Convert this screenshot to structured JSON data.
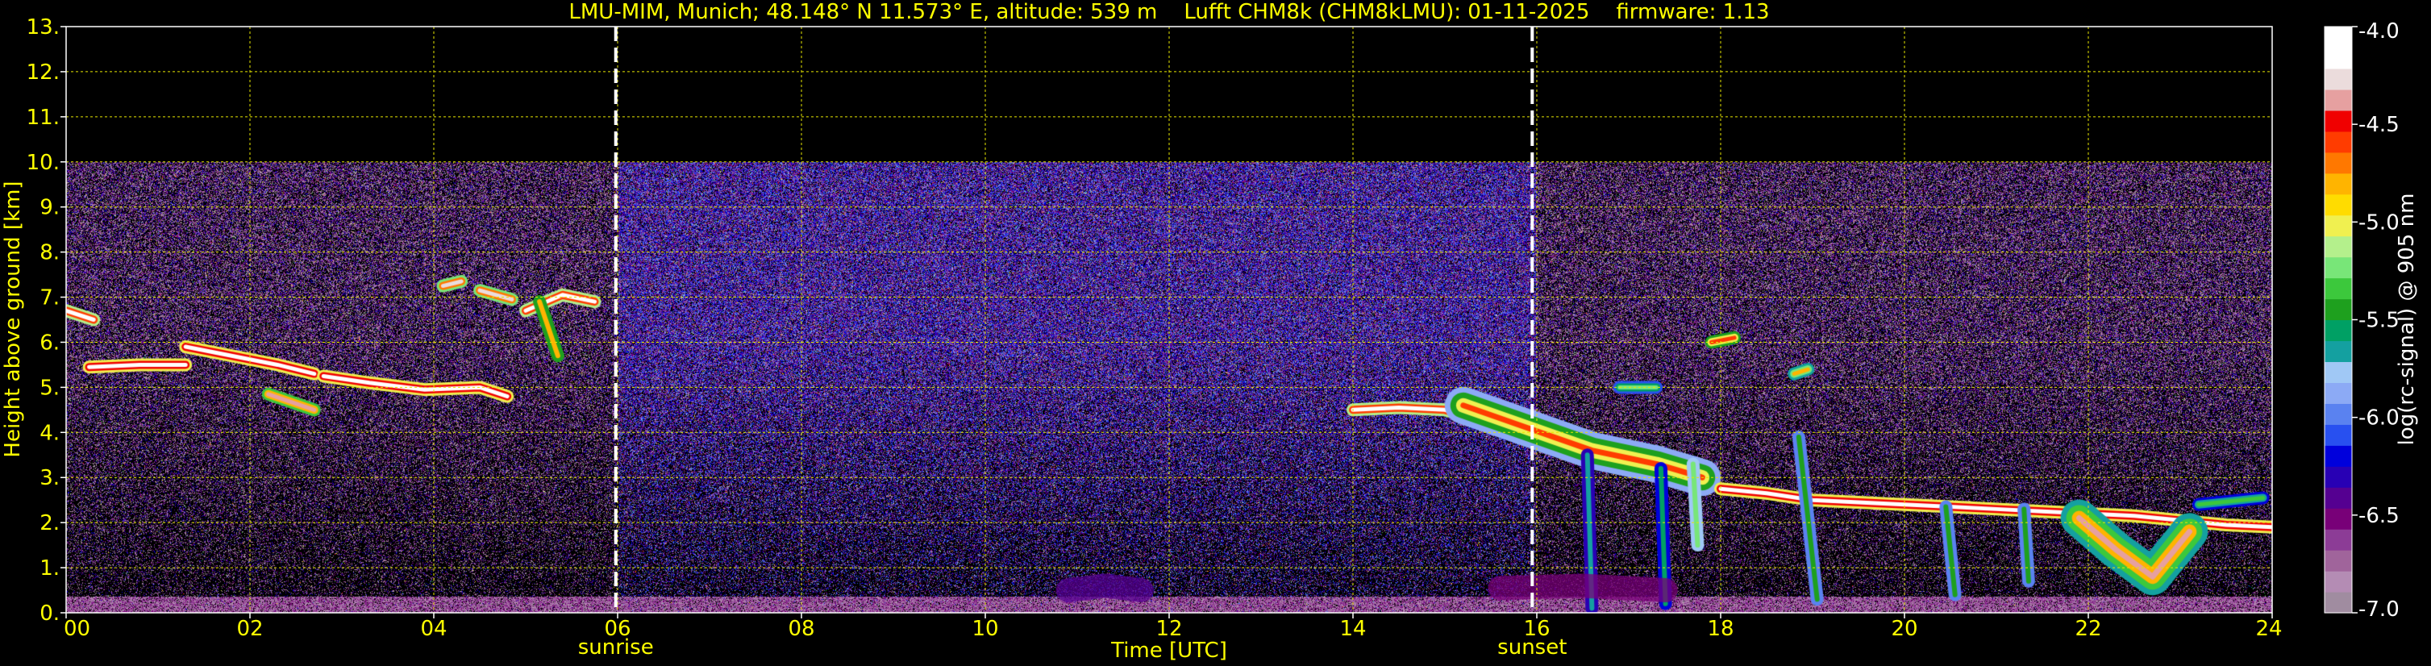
{
  "chart_data": {
    "type": "heatmap",
    "title": "LMU-MIM, Munich; 48.148° N 11.573° E, altitude: 539 m    Lufft CHM8k (CHM8kLMU): 01-11-2025    firmware: 1.13",
    "xlabel": "Time [UTC]",
    "ylabel": "Height above ground [km]",
    "xlim": [
      0,
      24
    ],
    "ylim": [
      0,
      13
    ],
    "grid": true,
    "x_ticks": [
      {
        "value": 0,
        "label": "00"
      },
      {
        "value": 2,
        "label": "02"
      },
      {
        "value": 4,
        "label": "04"
      },
      {
        "value": 6,
        "label": "06"
      },
      {
        "value": 8,
        "label": "08"
      },
      {
        "value": 10,
        "label": "10"
      },
      {
        "value": 12,
        "label": "12"
      },
      {
        "value": 14,
        "label": "14"
      },
      {
        "value": 16,
        "label": "16"
      },
      {
        "value": 18,
        "label": "18"
      },
      {
        "value": 20,
        "label": "20"
      },
      {
        "value": 22,
        "label": "22"
      },
      {
        "value": 24,
        "label": "24"
      }
    ],
    "y_ticks": [
      {
        "value": 0,
        "label": "0."
      },
      {
        "value": 1,
        "label": "1."
      },
      {
        "value": 2,
        "label": "2."
      },
      {
        "value": 3,
        "label": "3."
      },
      {
        "value": 4,
        "label": "4."
      },
      {
        "value": 5,
        "label": "5."
      },
      {
        "value": 6,
        "label": "6."
      },
      {
        "value": 7,
        "label": "7."
      },
      {
        "value": 8,
        "label": "8."
      },
      {
        "value": 9,
        "label": "9."
      },
      {
        "value": 10,
        "label": "10."
      },
      {
        "value": 11,
        "label": "11."
      },
      {
        "value": 12,
        "label": "12."
      },
      {
        "value": 13,
        "label": "13."
      }
    ],
    "markers": [
      {
        "time": 5.98,
        "label": "sunrise"
      },
      {
        "time": 15.95,
        "label": "sunset"
      }
    ],
    "signal_top_km": 10,
    "colorbar": {
      "label": "log(rc-signal) @ 905 nm",
      "range": [
        -7.0,
        -4.0
      ],
      "ticks": [
        {
          "value": -4.0,
          "label": "-4.0"
        },
        {
          "value": -4.5,
          "label": "-4.5"
        },
        {
          "value": -5.0,
          "label": "-5.0"
        },
        {
          "value": -5.5,
          "label": "-5.5"
        },
        {
          "value": -6.0,
          "label": "-6.0"
        },
        {
          "value": -6.5,
          "label": "-6.5"
        },
        {
          "value": -7.0,
          "label": "-7.0"
        }
      ],
      "colors": [
        "#a08ca0",
        "#b48cb4",
        "#a0649b",
        "#8c3c96",
        "#780078",
        "#550091",
        "#2800b4",
        "#0000dc",
        "#2850f0",
        "#5a82f0",
        "#8caaf5",
        "#a0c8f5",
        "#14a0a0",
        "#00a064",
        "#1ea01e",
        "#3cc83c",
        "#78e678",
        "#b4f08c",
        "#f0f050",
        "#ffdc00",
        "#ffb400",
        "#ff7800",
        "#ff3c00",
        "#f00000",
        "#e6a0a0",
        "#ebdcdc",
        "#ffffff",
        "#ffffff"
      ]
    },
    "features": [
      {
        "kind": "cloud",
        "level": -4.2,
        "points": [
          [
            0.0,
            6.7
          ],
          [
            0.3,
            6.5
          ]
        ]
      },
      {
        "kind": "cloud",
        "level": -4.1,
        "points": [
          [
            0.25,
            5.45
          ],
          [
            0.8,
            5.5
          ],
          [
            1.3,
            5.5
          ]
        ]
      },
      {
        "kind": "cloud",
        "level": -4.1,
        "points": [
          [
            1.3,
            5.9
          ],
          [
            1.8,
            5.7
          ],
          [
            2.3,
            5.5
          ],
          [
            2.7,
            5.3
          ]
        ]
      },
      {
        "kind": "cloud",
        "level": -4.1,
        "points": [
          [
            2.8,
            5.25
          ],
          [
            3.3,
            5.1
          ],
          [
            3.9,
            4.95
          ],
          [
            4.5,
            5.0
          ],
          [
            4.8,
            4.8
          ]
        ]
      },
      {
        "kind": "cloud",
        "level": -4.4,
        "points": [
          [
            2.2,
            4.85
          ],
          [
            2.7,
            4.5
          ]
        ]
      },
      {
        "kind": "cloud",
        "level": -4.3,
        "points": [
          [
            4.1,
            7.25
          ],
          [
            4.3,
            7.35
          ]
        ]
      },
      {
        "kind": "cloud",
        "level": -4.3,
        "points": [
          [
            4.5,
            7.15
          ],
          [
            4.85,
            6.95
          ]
        ]
      },
      {
        "kind": "cloud",
        "level": -4.2,
        "points": [
          [
            5.0,
            6.7
          ],
          [
            5.4,
            7.05
          ],
          [
            5.75,
            6.9
          ]
        ]
      },
      {
        "kind": "virga",
        "level": -5.4,
        "points": [
          [
            5.15,
            6.9
          ],
          [
            5.35,
            5.7
          ]
        ]
      },
      {
        "kind": "cloud",
        "level": -4.2,
        "points": [
          [
            14.0,
            4.5
          ],
          [
            14.5,
            4.55
          ],
          [
            15.0,
            4.5
          ],
          [
            15.5,
            4.2
          ],
          [
            15.9,
            3.9
          ],
          [
            16.3,
            3.6
          ],
          [
            16.8,
            3.5
          ],
          [
            17.3,
            3.3
          ],
          [
            17.8,
            3.2
          ]
        ]
      },
      {
        "kind": "precip",
        "level": -5.0,
        "points": [
          [
            15.2,
            4.6
          ],
          [
            15.9,
            4.1
          ],
          [
            16.6,
            3.6
          ],
          [
            17.3,
            3.3
          ],
          [
            17.8,
            3.0
          ]
        ]
      },
      {
        "kind": "cloud",
        "level": -4.1,
        "points": [
          [
            18.0,
            2.75
          ],
          [
            18.5,
            2.65
          ],
          [
            19.0,
            2.5
          ],
          [
            19.5,
            2.45
          ],
          [
            20.0,
            2.4
          ],
          [
            20.5,
            2.35
          ],
          [
            21.0,
            2.3
          ],
          [
            21.5,
            2.25
          ],
          [
            22.0,
            2.2
          ],
          [
            22.5,
            2.15
          ],
          [
            23.0,
            2.05
          ],
          [
            23.5,
            1.95
          ],
          [
            24.0,
            1.9
          ]
        ]
      },
      {
        "kind": "precip",
        "level": -4.8,
        "points": [
          [
            21.9,
            2.1
          ],
          [
            22.3,
            1.4
          ],
          [
            22.7,
            0.8
          ],
          [
            23.1,
            1.8
          ]
        ]
      },
      {
        "kind": "virga",
        "level": -6.3,
        "points": [
          [
            16.55,
            3.5
          ],
          [
            16.6,
            0.1
          ]
        ]
      },
      {
        "kind": "virga",
        "level": -6.2,
        "points": [
          [
            17.35,
            3.2
          ],
          [
            17.4,
            0.2
          ]
        ]
      },
      {
        "kind": "virga",
        "level": -5.8,
        "points": [
          [
            17.7,
            3.3
          ],
          [
            17.75,
            1.5
          ]
        ]
      },
      {
        "kind": "virga",
        "level": -6.0,
        "points": [
          [
            18.85,
            3.9
          ],
          [
            19.05,
            0.3
          ]
        ]
      },
      {
        "kind": "virga",
        "level": -6.0,
        "points": [
          [
            20.45,
            2.35
          ],
          [
            20.55,
            0.4
          ]
        ]
      },
      {
        "kind": "virga",
        "level": -6.0,
        "points": [
          [
            21.3,
            2.3
          ],
          [
            21.35,
            0.7
          ]
        ]
      },
      {
        "kind": "cloud",
        "level": -4.6,
        "points": [
          [
            17.9,
            6.0
          ],
          [
            18.15,
            6.1
          ]
        ]
      },
      {
        "kind": "cloud",
        "level": -4.8,
        "points": [
          [
            18.8,
            5.3
          ],
          [
            18.95,
            5.4
          ]
        ]
      },
      {
        "kind": "cloud",
        "level": -5.2,
        "points": [
          [
            16.9,
            5.0
          ],
          [
            17.3,
            5.0
          ]
        ]
      },
      {
        "kind": "cloud",
        "level": -5.3,
        "points": [
          [
            23.2,
            2.4
          ],
          [
            23.9,
            2.55
          ]
        ]
      },
      {
        "kind": "aerosol",
        "level": -6.4,
        "points": [
          [
            10.9,
            0.5
          ],
          [
            11.3,
            0.6
          ],
          [
            11.7,
            0.5
          ]
        ]
      },
      {
        "kind": "aerosol",
        "level": -6.5,
        "points": [
          [
            15.6,
            0.55
          ],
          [
            16.5,
            0.6
          ],
          [
            17.4,
            0.5
          ]
        ]
      }
    ],
    "background": {
      "noise_level_day": -6.3,
      "noise_level_night": -6.6,
      "boundary_layer_km": 0.35,
      "boundary_layer_level": -6.7
    }
  }
}
